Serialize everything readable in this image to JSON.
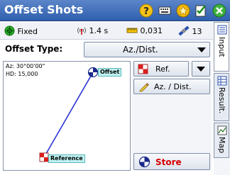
{
  "window": {
    "title": "Offset Shots"
  },
  "status": {
    "solution": "Fixed",
    "interval": "1.4 s",
    "precision": "0,031",
    "satellites": "13"
  },
  "offset": {
    "label": "Offset Type:",
    "value": "Az./Dist."
  },
  "graphic": {
    "az": "Az: 30°00'00\"",
    "hd": "HD: 15,000",
    "offset_point": "Offset",
    "reference_point": "Reference"
  },
  "controls": {
    "ref_label": "Ref.",
    "azdist_label": "Az. / Dist.",
    "store_label": "Store"
  },
  "tabs": [
    "Input",
    "Result.",
    "Map"
  ],
  "colors": {
    "title_bar": "#2f5fae",
    "line": "#2a33d6",
    "store_text": "#d40000",
    "label_bg": "#bff2f2"
  }
}
